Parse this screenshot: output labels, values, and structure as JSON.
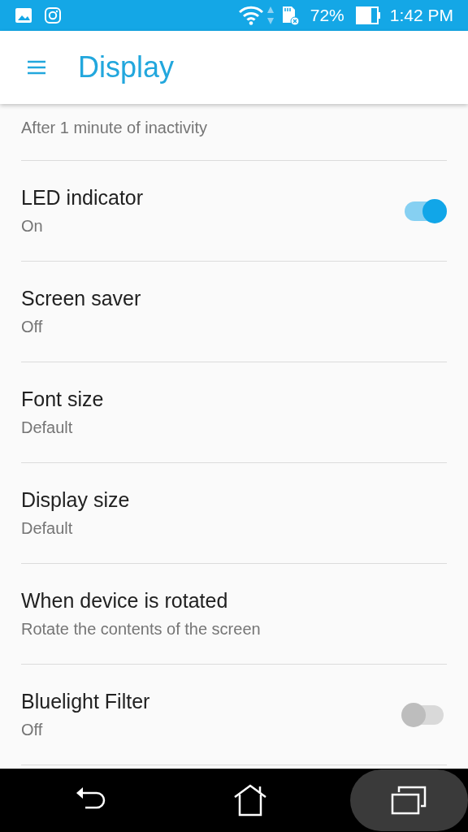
{
  "status_bar": {
    "battery": "72%",
    "time": "1:42 PM"
  },
  "header": {
    "title": "Display"
  },
  "settings": [
    {
      "kind": "plain",
      "subtitle": "After 1 minute of inactivity"
    },
    {
      "kind": "toggle",
      "title": "LED indicator",
      "subtitle": "On",
      "on": true
    },
    {
      "kind": "plain",
      "title": "Screen saver",
      "subtitle": "Off"
    },
    {
      "kind": "plain",
      "title": "Font size",
      "subtitle": "Default"
    },
    {
      "kind": "plain",
      "title": "Display size",
      "subtitle": "Default"
    },
    {
      "kind": "plain",
      "title": "When device is rotated",
      "subtitle": "Rotate the contents of the screen"
    },
    {
      "kind": "toggle",
      "title": "Bluelight Filter",
      "subtitle": "Off",
      "on": false
    }
  ],
  "nav_bar": {
    "buttons": [
      {
        "kind": "back",
        "selected": false
      },
      {
        "kind": "home",
        "selected": false
      },
      {
        "kind": "recents",
        "selected": true
      }
    ]
  }
}
